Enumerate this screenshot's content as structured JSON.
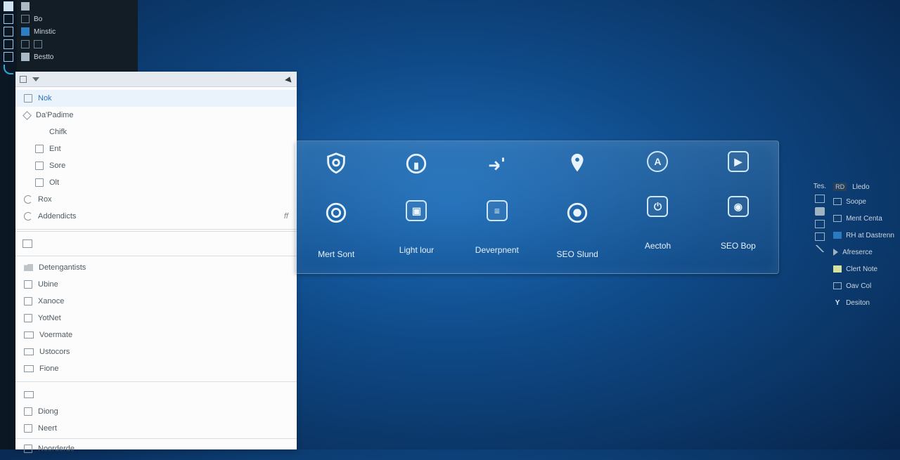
{
  "leftRail": {},
  "darkStrip": {
    "items": [
      {
        "label": "Bo"
      },
      {
        "label": "Minstic"
      },
      {
        "label": ""
      },
      {
        "label": "Bestto"
      }
    ]
  },
  "menu": {
    "top": [
      {
        "label": "Nok",
        "highlight": true
      },
      {
        "label": "Da'Padime"
      },
      {
        "label": "Chifk",
        "sub": true
      },
      {
        "label": "Ent",
        "sub": true
      },
      {
        "label": "Sore",
        "sub": true
      },
      {
        "label": "Olt",
        "sub": true
      },
      {
        "label": "Rox"
      },
      {
        "label": "Addendicts",
        "trail": "ff"
      }
    ],
    "mid": [
      {
        "label": "Detengantists"
      },
      {
        "label": "Ubine"
      },
      {
        "label": "Xanoce"
      },
      {
        "label": "YotNet"
      },
      {
        "label": "Voermate"
      },
      {
        "label": "Ustocors"
      },
      {
        "label": "Fione"
      }
    ],
    "bottom": [
      {
        "label": "Diong"
      },
      {
        "label": "Neert"
      },
      {
        "label": "Noorderde"
      }
    ]
  },
  "tray": {
    "tiles": [
      {
        "caption": "Mert Sont"
      },
      {
        "caption": "Light lour"
      },
      {
        "caption": "Deverpnent"
      },
      {
        "caption": "SEO Slund"
      },
      {
        "caption": "Aectoh"
      },
      {
        "caption": "SEO Bop"
      }
    ]
  },
  "gadgets": {
    "header": {
      "badgeLeft": "Tes.",
      "badgeMid": "RD",
      "title": "Lledo"
    },
    "list": [
      {
        "label": "Soope"
      },
      {
        "label": "Ment Centa"
      },
      {
        "label": "RH at Dastrenn"
      },
      {
        "label": "Afreserce"
      },
      {
        "label": "Clert Note"
      },
      {
        "label": "Oav Col"
      },
      {
        "label": "Desiton"
      }
    ]
  }
}
